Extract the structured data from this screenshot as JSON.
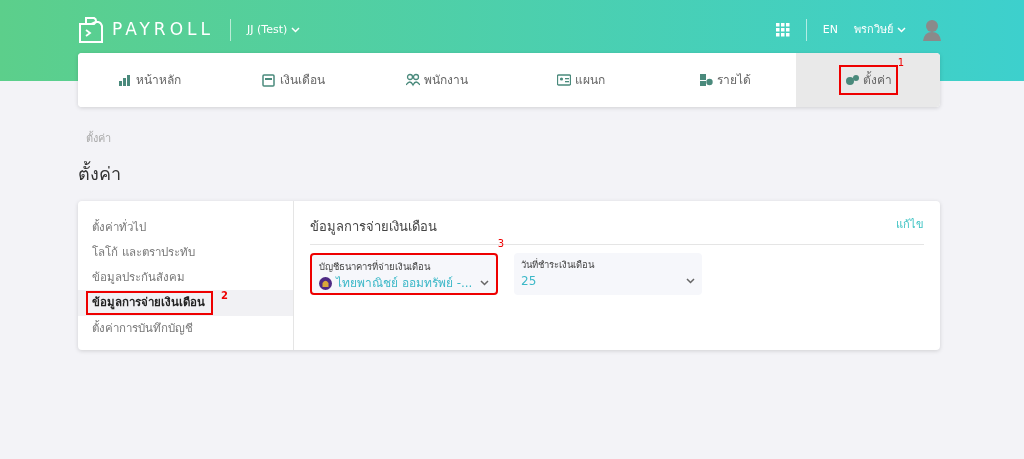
{
  "header": {
    "brand": "PAYROLL",
    "company": "JJ (Test)",
    "language": "EN",
    "user": "พรกวิษย์"
  },
  "nav_tabs": [
    {
      "label": "หน้าหลัก",
      "selected": false,
      "highlighted": false
    },
    {
      "label": "เงินเดือน",
      "selected": false,
      "highlighted": false
    },
    {
      "label": "พนักงาน",
      "selected": false,
      "highlighted": false
    },
    {
      "label": "แผนก",
      "selected": false,
      "highlighted": false
    },
    {
      "label": "รายได้",
      "selected": false,
      "highlighted": false
    },
    {
      "label": "ตั้งค่า",
      "selected": true,
      "highlighted": true,
      "marker": "1"
    }
  ],
  "breadcrumb": "ตั้งค่า",
  "page_title": "ตั้งค่า",
  "sidebar": {
    "items": [
      {
        "label": "ตั้งค่าทั่วไป",
        "selected": false,
        "highlighted": false
      },
      {
        "label": "โลโก้ และตราประทับ",
        "selected": false,
        "highlighted": false
      },
      {
        "label": "ข้อมูลประกันสังคม",
        "selected": false,
        "highlighted": false
      },
      {
        "label": "ข้อมูลการจ่ายเงินเดือน",
        "selected": true,
        "highlighted": true,
        "marker": "2"
      },
      {
        "label": "ตั้งค่าการบันทึกบัญชี",
        "selected": false,
        "highlighted": false
      }
    ]
  },
  "panel": {
    "title": "ข้อมูลการจ่ายเงินเดือน",
    "edit_link": "แก้ไข",
    "fields": [
      {
        "label": "บัญชีธนาคารที่จ่ายเงินเดือน",
        "value": "ไทยพาณิชย์ ออมทรัพย์ -...",
        "has_bank_icon": true,
        "highlighted": true,
        "marker": "3"
      },
      {
        "label": "วันที่ชำระเงินเดือน",
        "value": "25",
        "has_bank_icon": false,
        "highlighted": false
      }
    ]
  }
}
